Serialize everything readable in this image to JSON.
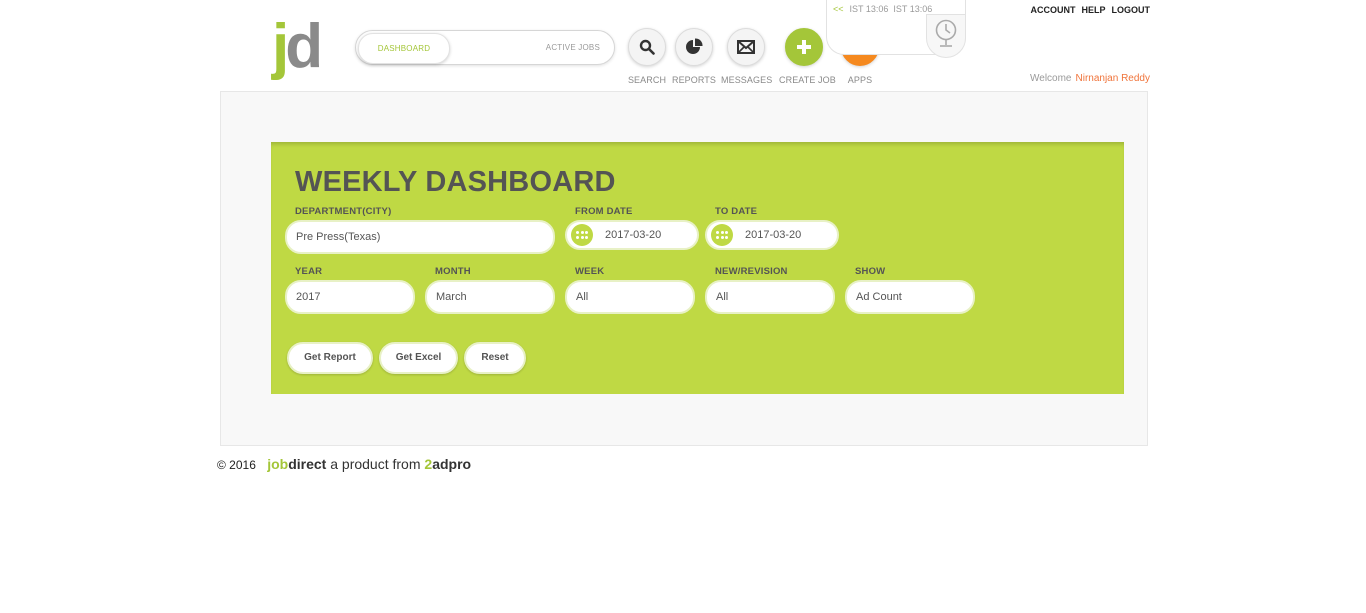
{
  "logo": {
    "j": "j",
    "d": "d"
  },
  "header_tabs": {
    "dashboard": "DASHBOARD",
    "active_jobs": "ACTIVE JOBS"
  },
  "nav": [
    {
      "label": "SEARCH",
      "icon": "search-icon"
    },
    {
      "label": "REPORTS",
      "icon": "pie-chart-icon"
    },
    {
      "label": "MESSAGES",
      "icon": "envelope-icon"
    },
    {
      "label": "CREATE JOB",
      "icon": "plus-icon"
    },
    {
      "label": "APPS",
      "icon": "grid-icon"
    }
  ],
  "clock": {
    "arrows": "<<",
    "time1": "IST 13:06",
    "time2": "IST 13:06"
  },
  "top_links": {
    "account": "ACCOUNT",
    "help": "HELP",
    "logout": "LOGOUT"
  },
  "welcome": {
    "prefix": "Welcome",
    "user": "Nirnanjan Reddy"
  },
  "dashboard": {
    "title": "WEEKLY DASHBOARD",
    "department": {
      "label": "DEPARTMENT(CITY)",
      "value": "Pre Press(Texas)"
    },
    "from_date": {
      "label": "FROM DATE",
      "value": "2017-03-20"
    },
    "to_date": {
      "label": "TO DATE",
      "value": "2017-03-20"
    },
    "year": {
      "label": "YEAR",
      "value": "2017"
    },
    "month": {
      "label": "MONTH",
      "value": "March"
    },
    "week": {
      "label": "WEEK",
      "value": "All"
    },
    "new_revision": {
      "label": "NEW/REVISION",
      "value": "All"
    },
    "show": {
      "label": "SHOW",
      "value": "Ad Count"
    },
    "buttons": {
      "get_report": "Get Report",
      "get_excel": "Get Excel",
      "reset": "Reset"
    }
  },
  "footer": {
    "copyright": "© 2016",
    "job": "job",
    "direct": "direct",
    "tagline": "a product from",
    "two": "2",
    "adpro": "adpro"
  },
  "colors": {
    "accent_green": "#bfd944",
    "brand_green": "#a4c639",
    "orange": "#f5891f",
    "username": "#f0743b"
  }
}
